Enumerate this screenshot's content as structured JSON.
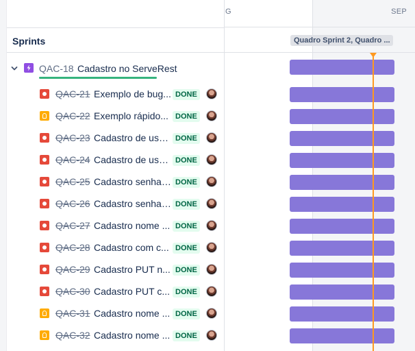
{
  "timeline": {
    "months": [
      "G",
      "SEP"
    ],
    "sprint_label": "Quadro Sprint 2, Quadro ..."
  },
  "sprints": {
    "title": "Sprints"
  },
  "parent": {
    "key": "QAC-18",
    "title": "Cadastro no ServeRest",
    "type_icon": "epic-icon",
    "progress_color": "#36b37e"
  },
  "issues": [
    {
      "key": "QAC-21",
      "title": "Exemplo de bug...",
      "status": "DONE",
      "type": "bug"
    },
    {
      "key": "QAC-22",
      "title": "Exemplo rápido...",
      "status": "DONE",
      "type": "improvement"
    },
    {
      "key": "QAC-23",
      "title": "Cadastro de usu...",
      "status": "DONE",
      "type": "bug"
    },
    {
      "key": "QAC-24",
      "title": "Cadastro de usu...",
      "status": "DONE",
      "type": "bug"
    },
    {
      "key": "QAC-25",
      "title": "Cadastro senha ...",
      "status": "DONE",
      "type": "bug"
    },
    {
      "key": "QAC-26",
      "title": "Cadastro senha ...",
      "status": "DONE",
      "type": "bug"
    },
    {
      "key": "QAC-27",
      "title": "Cadastro nome ...",
      "status": "DONE",
      "type": "bug"
    },
    {
      "key": "QAC-28",
      "title": "Cadastro com c...",
      "status": "DONE",
      "type": "bug"
    },
    {
      "key": "QAC-29",
      "title": "Cadastro PUT n...",
      "status": "DONE",
      "type": "bug"
    },
    {
      "key": "QAC-30",
      "title": "Cadastro PUT c...",
      "status": "DONE",
      "type": "bug"
    },
    {
      "key": "QAC-31",
      "title": "Cadastro nome ...",
      "status": "DONE",
      "type": "improvement"
    },
    {
      "key": "QAC-32",
      "title": "Cadastro nome ...",
      "status": "DONE",
      "type": "improvement"
    }
  ],
  "colors": {
    "bar": "#8777d9",
    "today": "#ff991f",
    "done_bg": "#e3fcef",
    "done_text": "#006644"
  }
}
